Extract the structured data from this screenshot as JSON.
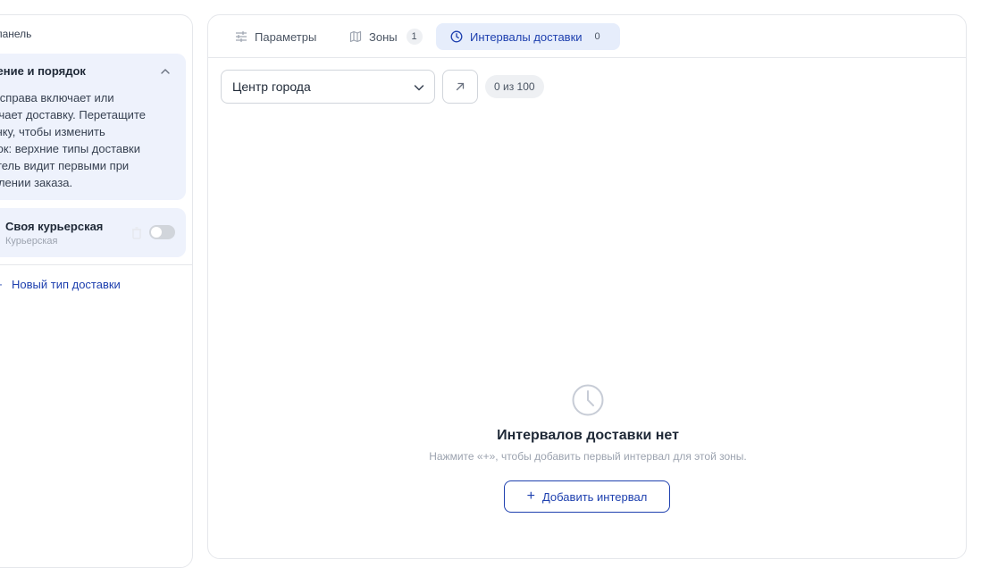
{
  "sidebar": {
    "collapse_label": "ть панель",
    "info": {
      "title": "чение и порядок",
      "lines": [
        "н справа включает или",
        "ючает доставку. Перетащите",
        "очку, чтобы изменить",
        "док: верхние типы доставки",
        "атель видит первыми при",
        "млении заказа."
      ]
    },
    "delivery_type": {
      "name": "Своя курьерская",
      "subtitle": "Курьерская",
      "enabled": false
    },
    "new_type_label": "Новый тип доставки"
  },
  "tabs": [
    {
      "label": "Параметры",
      "icon": "sliders-icon"
    },
    {
      "label": "Зоны",
      "icon": "map-icon",
      "count": "1"
    },
    {
      "label": "Интервалы доставки",
      "icon": "clock-icon",
      "count": "0",
      "active": true
    }
  ],
  "zone_select": {
    "value": "Центр города"
  },
  "limit_badge": "0 из 100",
  "empty_state": {
    "title": "Интервалов доставки нет",
    "description": "Нажмите «+», чтобы добавить первый интервал для этой зоны.",
    "button_label": "Добавить интервал"
  },
  "colors": {
    "accent": "#1e40af",
    "active_tab_bg": "#e6edfb",
    "card_bg": "#eef2fc"
  }
}
